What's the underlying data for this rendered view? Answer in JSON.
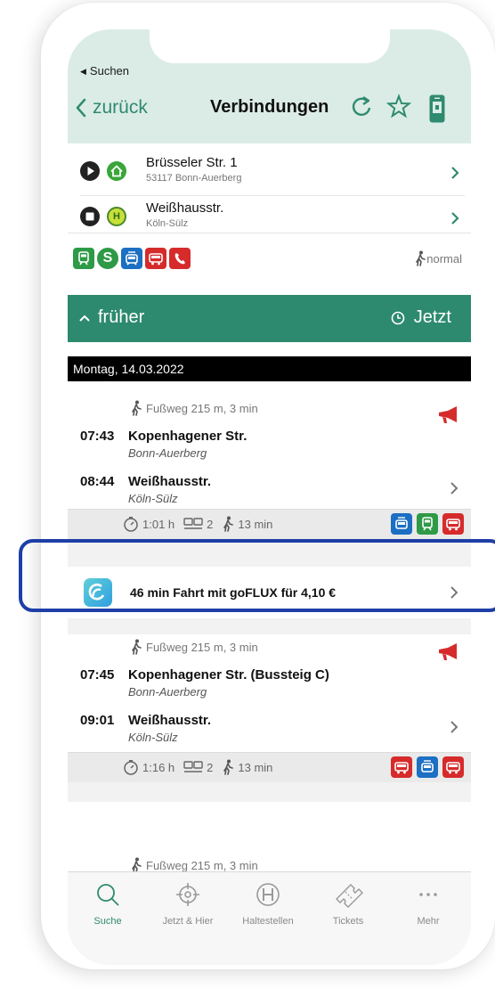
{
  "status": {
    "back_app": "Suchen"
  },
  "nav": {
    "back_label": "zurück",
    "title": "Verbindungen"
  },
  "route": {
    "from": {
      "name": "Brüsseler Str. 1",
      "sub": "53117 Bonn-Auerberg"
    },
    "to": {
      "name": "Weißhausstr.",
      "sub": "Köln-Sülz",
      "stop_letter": "H"
    },
    "modes": [
      "train-icon",
      "s-bahn-icon",
      "tram-icon",
      "bus-icon",
      "phone-taxi-icon"
    ],
    "walk_speed": "normal"
  },
  "earlier": {
    "label": "früher",
    "now_label": "Jetzt"
  },
  "date": "Montag, 14.03.2022",
  "connections": [
    {
      "walk": "Fußweg 215 m, 3 min",
      "dep_time": "07:43",
      "dep_place": "Kopenhagener Str.",
      "dep_city": "Bonn-Auerberg",
      "arr_time": "08:44",
      "arr_place": "Weißhausstr.",
      "arr_city": "Köln-Sülz",
      "duration": "1:01 h",
      "changes": "2",
      "walk_min": "13 min",
      "modes": [
        "tram-icon",
        "train-icon",
        "bus-icon"
      ]
    },
    {
      "walk": "Fußweg 215 m, 3 min",
      "dep_time": "07:45",
      "dep_place": "Kopenhagener Str. (Bussteig C)",
      "dep_city": "Bonn-Auerberg",
      "arr_time": "09:01",
      "arr_place": "Weißhausstr.",
      "arr_city": "Köln-Sülz",
      "duration": "1:16 h",
      "changes": "2",
      "walk_min": "13 min",
      "modes": [
        "bus-icon",
        "tram-icon",
        "bus-icon"
      ]
    }
  ],
  "flux_offer": {
    "text": "46 min Fahrt mit goFLUX für 4,10 €"
  },
  "next_walk": "Fußweg 215 m, 3 min",
  "tabs": [
    {
      "label": "Suche",
      "icon": "search-icon",
      "active": true
    },
    {
      "label": "Jetzt & Hier",
      "icon": "crosshair-icon",
      "active": false
    },
    {
      "label": "Haltestellen",
      "icon": "stop-h-icon",
      "active": false
    },
    {
      "label": "Tickets",
      "icon": "ticket-icon",
      "active": false
    },
    {
      "label": "Mehr",
      "icon": "more-icon",
      "active": false
    }
  ],
  "colors": {
    "accent": "#2d8a6e",
    "header_bg": "#dbece6",
    "highlight": "#1d3fa6",
    "alert_red": "#d62b2b",
    "mode_blue": "#1c6fc2",
    "mode_green": "#2e9a47"
  }
}
